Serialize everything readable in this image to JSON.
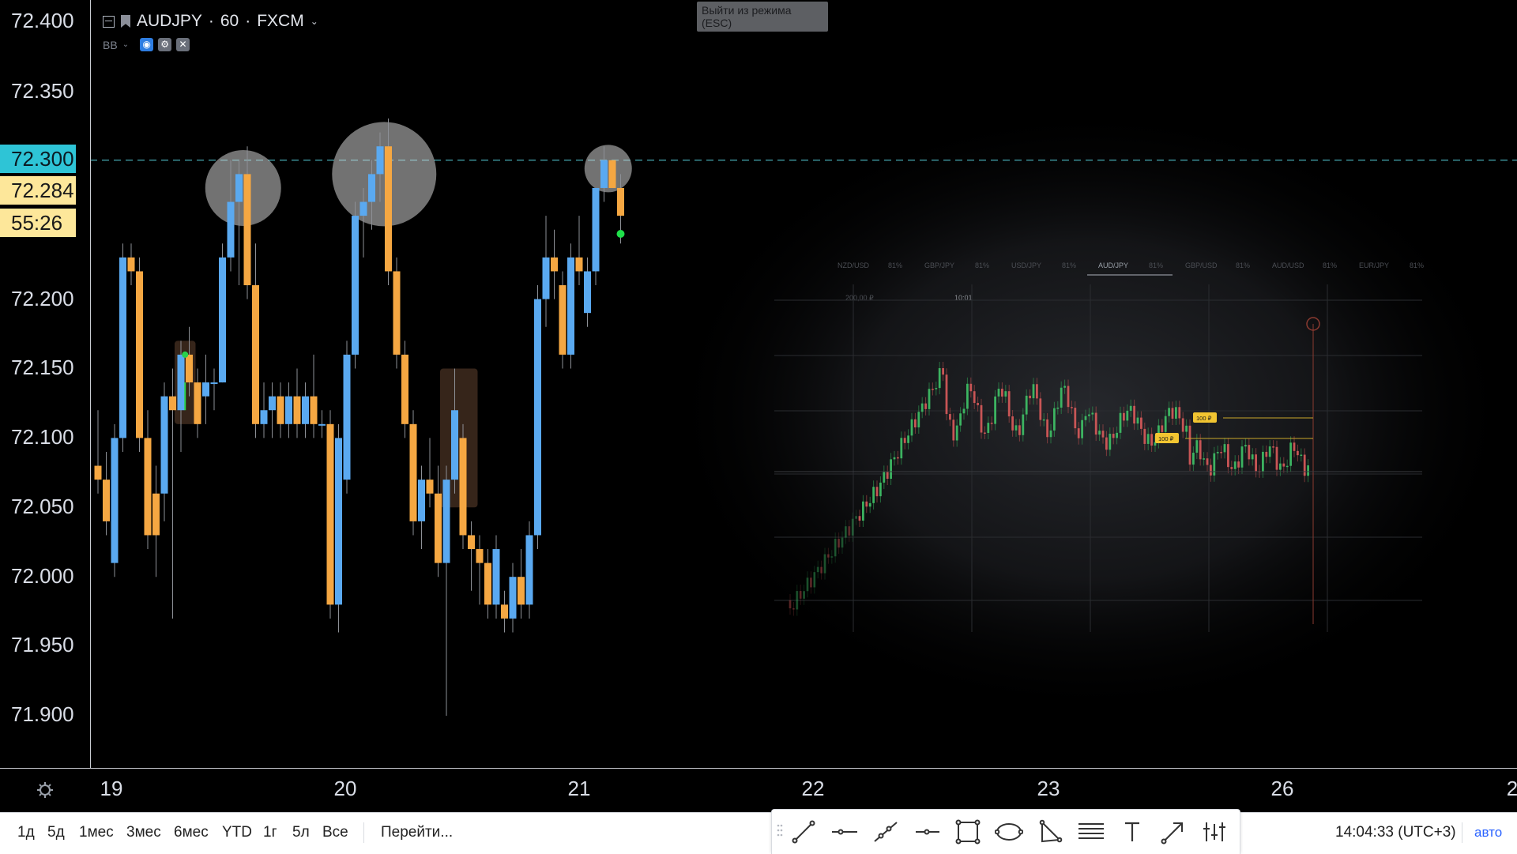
{
  "symbol": {
    "name": "AUDJPY",
    "interval": "60",
    "exchange": "FXCM"
  },
  "indicator": {
    "name": "BB"
  },
  "tooltip": {
    "line1": "Выйти из режима",
    "line2": "(ESC)"
  },
  "price_axis": {
    "labels": [
      "72.400",
      "72.350",
      "72.200",
      "72.150",
      "72.100",
      "72.050",
      "72.000",
      "71.950",
      "71.900"
    ],
    "level_badge": "72.300",
    "current_price": "72.284",
    "countdown": "55:26"
  },
  "time_axis": {
    "dates": [
      "19",
      "20",
      "21",
      "22",
      "23",
      "26",
      "2"
    ]
  },
  "ranges": [
    "1д",
    "5д",
    "1мес",
    "3мес",
    "6мес",
    "YTD",
    "1г",
    "5л",
    "Все"
  ],
  "goto_label": "Перейти...",
  "clock": "14:04:33 (UTC+3)",
  "auto_label": "авто",
  "drawing_tools": [
    "trend-line",
    "horizontal-line",
    "ray",
    "horizontal-ray",
    "rectangle",
    "ellipse",
    "triangle",
    "parallel-channel",
    "text",
    "arrow",
    "long-position"
  ],
  "colors": {
    "up": "#5aa9f0",
    "down": "#f5a742",
    "level_line": "#3a8c94",
    "level_badge_bg": "#2ec4d6",
    "price_badge_bg": "#fde79a",
    "background": "#000000"
  },
  "overlay_screenshot": {
    "pairs": [
      {
        "name": "NZD/USD",
        "pct": "81%"
      },
      {
        "name": "GBP/JPY",
        "pct": "81%"
      },
      {
        "name": "USD/JPY",
        "pct": "81%"
      },
      {
        "name": "AUD/JPY",
        "pct": "81%"
      },
      {
        "name": "GBP/USD",
        "pct": "81%"
      },
      {
        "name": "AUD/USD",
        "pct": "81%"
      },
      {
        "name": "EUR/JPY",
        "pct": "81%"
      }
    ],
    "active_pair": "AUD/JPY",
    "amount_label": "200,00 ₽",
    "time_label": "10:01",
    "bet_labels": [
      "100 ₽",
      "100 ₽"
    ]
  },
  "chart_data": {
    "type": "candlestick",
    "symbol": "AUDJPY",
    "ylim": [
      71.87,
      72.42
    ],
    "x_categories": [
      "19",
      "20",
      "21",
      "22",
      "23",
      "26"
    ],
    "candles": [
      {
        "o": 72.08,
        "h": 72.12,
        "l": 72.06,
        "c": 72.07
      },
      {
        "o": 72.07,
        "h": 72.09,
        "l": 72.03,
        "c": 72.04
      },
      {
        "o": 72.01,
        "h": 72.11,
        "l": 72.0,
        "c": 72.1
      },
      {
        "o": 72.1,
        "h": 72.24,
        "l": 72.09,
        "c": 72.23
      },
      {
        "o": 72.23,
        "h": 72.24,
        "l": 72.21,
        "c": 72.22
      },
      {
        "o": 72.22,
        "h": 72.23,
        "l": 72.09,
        "c": 72.1
      },
      {
        "o": 72.1,
        "h": 72.12,
        "l": 72.02,
        "c": 72.03
      },
      {
        "o": 72.06,
        "h": 72.08,
        "l": 72.0,
        "c": 72.03
      },
      {
        "o": 72.06,
        "h": 72.14,
        "l": 72.04,
        "c": 72.13
      },
      {
        "o": 72.13,
        "h": 72.15,
        "l": 71.97,
        "c": 72.12
      },
      {
        "o": 72.12,
        "h": 72.17,
        "l": 72.09,
        "c": 72.16
      },
      {
        "o": 72.16,
        "h": 72.18,
        "l": 72.13,
        "c": 72.14
      },
      {
        "o": 72.14,
        "h": 72.15,
        "l": 72.1,
        "c": 72.11
      },
      {
        "o": 72.13,
        "h": 72.16,
        "l": 72.11,
        "c": 72.14
      },
      {
        "o": 72.14,
        "h": 72.15,
        "l": 72.12,
        "c": 72.14
      },
      {
        "o": 72.14,
        "h": 72.24,
        "l": 72.14,
        "c": 72.23
      },
      {
        "o": 72.23,
        "h": 72.3,
        "l": 72.22,
        "c": 72.27
      },
      {
        "o": 72.27,
        "h": 72.3,
        "l": 72.21,
        "c": 72.29
      },
      {
        "o": 72.29,
        "h": 72.31,
        "l": 72.2,
        "c": 72.21
      },
      {
        "o": 72.21,
        "h": 72.24,
        "l": 72.1,
        "c": 72.11
      },
      {
        "o": 72.11,
        "h": 72.14,
        "l": 72.1,
        "c": 72.12
      },
      {
        "o": 72.12,
        "h": 72.14,
        "l": 72.1,
        "c": 72.13
      },
      {
        "o": 72.13,
        "h": 72.14,
        "l": 72.1,
        "c": 72.11
      },
      {
        "o": 72.11,
        "h": 72.14,
        "l": 72.1,
        "c": 72.13
      },
      {
        "o": 72.13,
        "h": 72.15,
        "l": 72.1,
        "c": 72.11
      },
      {
        "o": 72.11,
        "h": 72.14,
        "l": 72.1,
        "c": 72.13
      },
      {
        "o": 72.13,
        "h": 72.16,
        "l": 72.1,
        "c": 72.11
      },
      {
        "o": 72.11,
        "h": 72.12,
        "l": 72.1,
        "c": 72.11
      },
      {
        "o": 72.11,
        "h": 72.12,
        "l": 71.97,
        "c": 71.98
      },
      {
        "o": 71.98,
        "h": 72.11,
        "l": 71.96,
        "c": 72.1
      },
      {
        "o": 72.07,
        "h": 72.17,
        "l": 72.06,
        "c": 72.16
      },
      {
        "o": 72.16,
        "h": 72.27,
        "l": 72.15,
        "c": 72.26
      },
      {
        "o": 72.26,
        "h": 72.28,
        "l": 72.23,
        "c": 72.27
      },
      {
        "o": 72.27,
        "h": 72.3,
        "l": 72.25,
        "c": 72.29
      },
      {
        "o": 72.29,
        "h": 72.32,
        "l": 72.27,
        "c": 72.31
      },
      {
        "o": 72.31,
        "h": 72.33,
        "l": 72.21,
        "c": 72.22
      },
      {
        "o": 72.22,
        "h": 72.23,
        "l": 72.15,
        "c": 72.16
      },
      {
        "o": 72.16,
        "h": 72.17,
        "l": 72.1,
        "c": 72.11
      },
      {
        "o": 72.11,
        "h": 72.12,
        "l": 72.03,
        "c": 72.04
      },
      {
        "o": 72.04,
        "h": 72.08,
        "l": 72.02,
        "c": 72.07
      },
      {
        "o": 72.07,
        "h": 72.1,
        "l": 72.05,
        "c": 72.06
      },
      {
        "o": 72.06,
        "h": 72.08,
        "l": 72.0,
        "c": 72.01
      },
      {
        "o": 72.01,
        "h": 72.08,
        "l": 71.9,
        "c": 72.07
      },
      {
        "o": 72.07,
        "h": 72.15,
        "l": 72.06,
        "c": 72.12
      },
      {
        "o": 72.1,
        "h": 72.11,
        "l": 72.02,
        "c": 72.03
      },
      {
        "o": 72.03,
        "h": 72.04,
        "l": 71.99,
        "c": 72.02
      },
      {
        "o": 72.02,
        "h": 72.03,
        "l": 71.98,
        "c": 72.01
      },
      {
        "o": 72.01,
        "h": 72.02,
        "l": 71.97,
        "c": 71.98
      },
      {
        "o": 71.98,
        "h": 72.03,
        "l": 71.97,
        "c": 72.02
      },
      {
        "o": 71.98,
        "h": 71.99,
        "l": 71.96,
        "c": 71.97
      },
      {
        "o": 71.97,
        "h": 72.01,
        "l": 71.96,
        "c": 72.0
      },
      {
        "o": 72.0,
        "h": 72.02,
        "l": 71.97,
        "c": 71.98
      },
      {
        "o": 71.98,
        "h": 72.04,
        "l": 71.97,
        "c": 72.03
      },
      {
        "o": 72.03,
        "h": 72.21,
        "l": 72.02,
        "c": 72.2
      },
      {
        "o": 72.2,
        "h": 72.26,
        "l": 72.18,
        "c": 72.23
      },
      {
        "o": 72.23,
        "h": 72.25,
        "l": 72.2,
        "c": 72.22
      },
      {
        "o": 72.21,
        "h": 72.22,
        "l": 72.15,
        "c": 72.16
      },
      {
        "o": 72.16,
        "h": 72.24,
        "l": 72.15,
        "c": 72.23
      },
      {
        "o": 72.23,
        "h": 72.26,
        "l": 72.21,
        "c": 72.22
      },
      {
        "o": 72.19,
        "h": 72.23,
        "l": 72.18,
        "c": 72.22
      },
      {
        "o": 72.22,
        "h": 72.28,
        "l": 72.21,
        "c": 72.28
      },
      {
        "o": 72.28,
        "h": 72.31,
        "l": 72.27,
        "c": 72.3
      },
      {
        "o": 72.3,
        "h": 72.3,
        "l": 72.28,
        "c": 72.28
      },
      {
        "o": 72.28,
        "h": 72.29,
        "l": 72.24,
        "c": 72.26
      }
    ],
    "level_line": 72.3,
    "highlight_circles": [
      {
        "center_index": 17.5,
        "price": 72.28
      },
      {
        "center_index": 34.5,
        "price": 72.29
      },
      {
        "center_index": 61.5,
        "price": 72.294
      }
    ],
    "highlight_boxes": [
      {
        "from_index": 10,
        "to_index": 11,
        "top": 72.17,
        "bottom": 72.11
      },
      {
        "from_index": 42,
        "to_index": 45,
        "top": 72.15,
        "bottom": 72.05
      }
    ]
  }
}
